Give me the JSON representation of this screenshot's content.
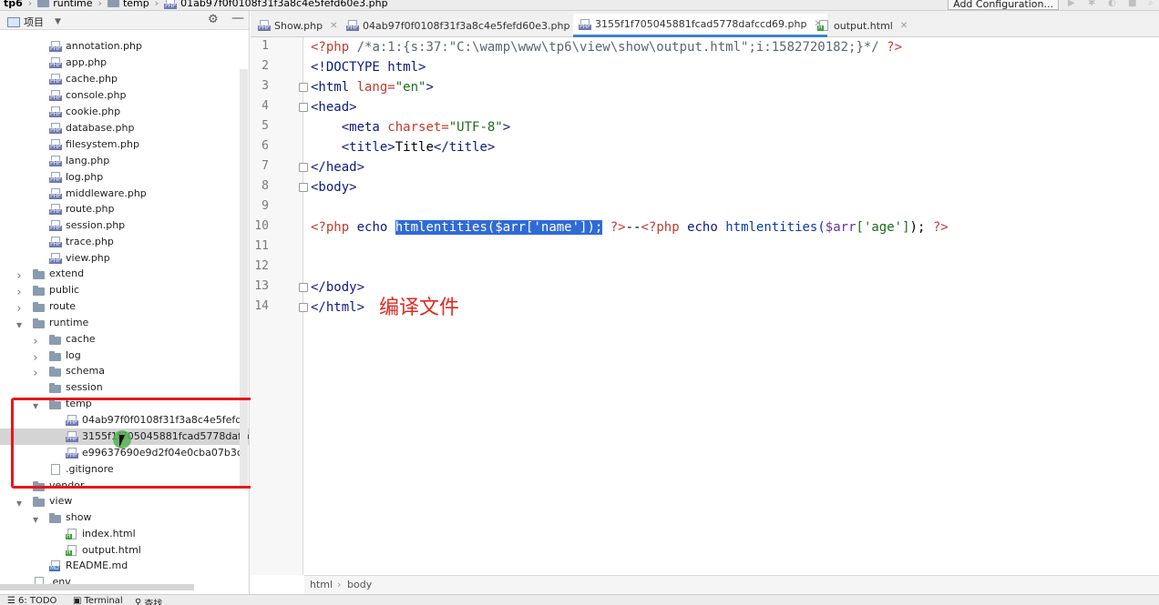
{
  "breadcrumb": {
    "items": [
      "tp6",
      "runtime",
      "temp",
      "01ab97f0f0108f31f3a8c4e5fefd60e3.php"
    ]
  },
  "toolbar": {
    "add_configuration": "Add Configuration..."
  },
  "project_panel": {
    "title": "项目"
  },
  "tree": [
    {
      "label": "annotation.php",
      "type": "php"
    },
    {
      "label": "app.php",
      "type": "php"
    },
    {
      "label": "cache.php",
      "type": "php"
    },
    {
      "label": "console.php",
      "type": "php"
    },
    {
      "label": "cookie.php",
      "type": "php"
    },
    {
      "label": "database.php",
      "type": "php"
    },
    {
      "label": "filesystem.php",
      "type": "php"
    },
    {
      "label": "lang.php",
      "type": "php"
    },
    {
      "label": "log.php",
      "type": "php"
    },
    {
      "label": "middleware.php",
      "type": "php"
    },
    {
      "label": "route.php",
      "type": "php"
    },
    {
      "label": "session.php",
      "type": "php"
    },
    {
      "label": "trace.php",
      "type": "php"
    },
    {
      "label": "view.php",
      "type": "php"
    },
    {
      "label": "extend",
      "type": "folder"
    },
    {
      "label": "public",
      "type": "folder"
    },
    {
      "label": "route",
      "type": "folder"
    },
    {
      "label": "runtime",
      "type": "folder"
    },
    {
      "label": "cache",
      "type": "folder"
    },
    {
      "label": "log",
      "type": "folder"
    },
    {
      "label": "schema",
      "type": "folder"
    },
    {
      "label": "session",
      "type": "folder"
    },
    {
      "label": "temp",
      "type": "folder"
    },
    {
      "label": "04ab97f0f0108f31f3a8c4e5fefd60e.",
      "type": "php"
    },
    {
      "label": "3155f1f705045881fcad5778dafccd6",
      "type": "php"
    },
    {
      "label": "e99637690e9d2f04e0cba07b3c31e",
      "type": "php"
    },
    {
      "label": ".gitignore",
      "type": "generic"
    },
    {
      "label": "vendor",
      "type": "folder"
    },
    {
      "label": "view",
      "type": "folder"
    },
    {
      "label": "show",
      "type": "folder"
    },
    {
      "label": "index.html",
      "type": "html"
    },
    {
      "label": "output.html",
      "type": "html"
    },
    {
      "label": "README.md",
      "type": "md"
    },
    {
      "label": ".env",
      "type": "generic"
    }
  ],
  "tabs": [
    {
      "label": "Show.php"
    },
    {
      "label": "04ab97f0f0108f31f3a8c4e5fefd60e3.php"
    },
    {
      "label": "3155f1f705045881fcad5778dafccd69.php"
    },
    {
      "label": "output.html"
    }
  ],
  "line_numbers": [
    "1",
    "2",
    "3",
    "4",
    "5",
    "6",
    "7",
    "8",
    "9",
    "10",
    "11",
    "12",
    "13",
    "14"
  ],
  "code": {
    "l1_open": "<?php",
    "l1_comment": " /*a:1:{s:37:\"C:\\wamp\\www\\tp6\\view\\show\\output.html\";i:1582720182;}*/ ",
    "l1_close": "?>",
    "l2": "<!DOCTYPE html>",
    "l3_tag": "<html ",
    "l3_attr": "lang=",
    "l3_val": "\"en\"",
    "l3_end": ">",
    "l4": "<head>",
    "l5_indent": "    ",
    "l5_tag": "<meta ",
    "l5_attr": "charset=",
    "l5_val": "\"UTF-8\"",
    "l5_end": ">",
    "l6_indent": "    ",
    "l6_open": "<title>",
    "l6_text": "Title",
    "l6_close": "</title>",
    "l7": "</head>",
    "l8": "<body>",
    "l10_php1": "<?php",
    "l10_echo1": " echo ",
    "l10_fn1": "htmlentities(",
    "l10_var1": "$arr",
    "l10_k1": "['name']",
    "l10_end1": ");",
    "l10_close1": " ?>",
    "l10_sep": "--",
    "l10_php2": "<?php",
    "l10_echo2": " echo ",
    "l10_fn2": "htmlentities(",
    "l10_var2": "$arr",
    "l10_k2": "['age']",
    "l10_end2": ");",
    "l10_close2": " ?>",
    "l13": "</body>",
    "l14": "</html>"
  },
  "annotation_text": "编译文件",
  "editor_breadcrumb": [
    "html",
    "body"
  ],
  "statusbar": {
    "todo": "6: TODO",
    "terminal": "Terminal",
    "find": "查找"
  }
}
